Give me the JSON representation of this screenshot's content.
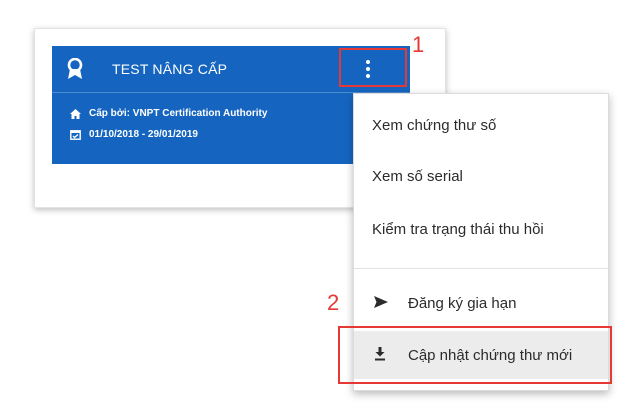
{
  "card": {
    "title": "TEST NÂNG CẤP",
    "issuer": "Cấp bởi: VNPT Certification Authority",
    "validity": "01/10/2018 - 29/01/2019",
    "header_color": "#1565c0",
    "header_icon": "award-icon",
    "menu_icon": "more-vert-icon",
    "issuer_icon": "home-icon",
    "validity_icon": "calendar-icon"
  },
  "menu": {
    "view_certificate": "Xem chứng thư số",
    "view_serial": "Xem số serial",
    "check_revocation": "Kiểm tra trạng thái thu hồi",
    "renew": "Đăng ký gia hạn",
    "renew_icon": "send-icon",
    "update_certificate": "Cập nhật chứng thư mới",
    "update_icon": "download-icon"
  },
  "annotations": {
    "step_1": "1",
    "step_2": "2",
    "color": "#e53935"
  }
}
